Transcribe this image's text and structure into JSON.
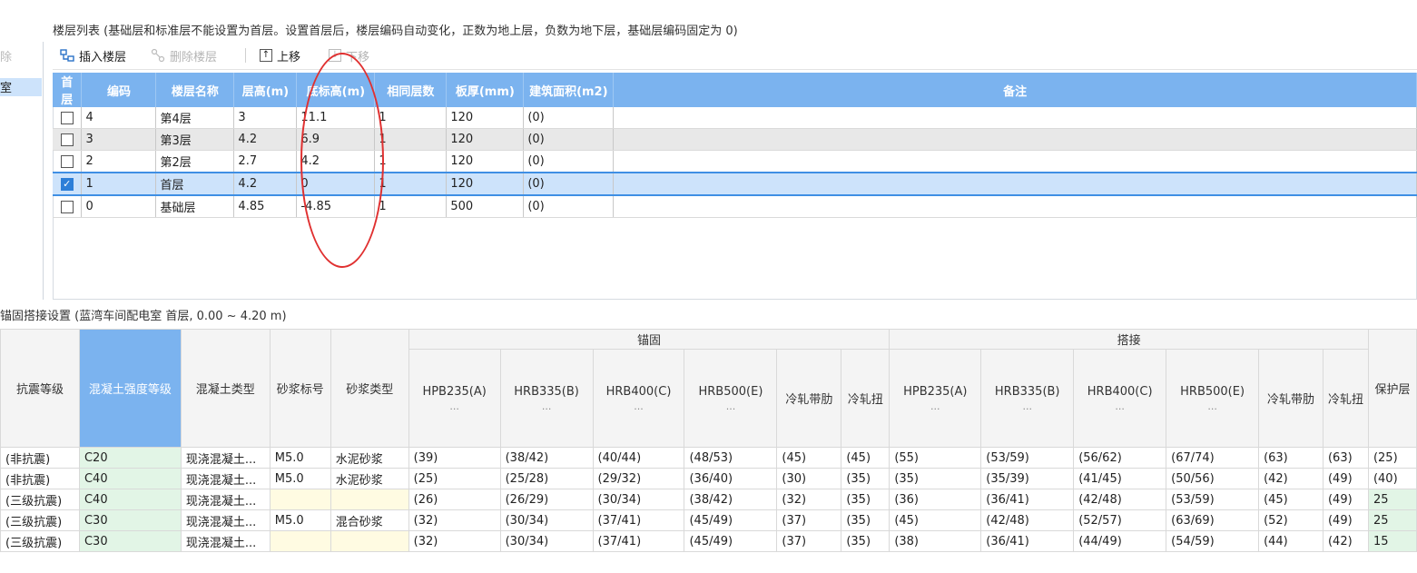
{
  "left": {
    "delete_label": "除",
    "selected_label": "室"
  },
  "floor_list": {
    "title": "楼层列表",
    "note": "(基础层和标准层不能设置为首层。设置首层后，楼层编码自动变化，正数为地上层，负数为地下层，基础层编码固定为 0)"
  },
  "toolbar": {
    "insert_label": "插入楼层",
    "delete_label": "删除楼层",
    "up_label": "上移",
    "down_label": "下移"
  },
  "floor_table": {
    "headers": [
      "首层",
      "编码",
      "楼层名称",
      "层高(m)",
      "底标高(m)",
      "相同层数",
      "板厚(mm)",
      "建筑面积(m2)",
      "备注"
    ],
    "rows": [
      {
        "first": false,
        "code": "4",
        "name": "第4层",
        "height": "3",
        "bottom": "11.1",
        "same": "1",
        "slab": "120",
        "area": "(0)",
        "remark": ""
      },
      {
        "first": false,
        "code": "3",
        "name": "第3层",
        "height": "4.2",
        "bottom": "6.9",
        "same": "1",
        "slab": "120",
        "area": "(0)",
        "remark": ""
      },
      {
        "first": false,
        "code": "2",
        "name": "第2层",
        "height": "2.7",
        "bottom": "4.2",
        "same": "1",
        "slab": "120",
        "area": "(0)",
        "remark": ""
      },
      {
        "first": true,
        "code": "1",
        "name": "首层",
        "height": "4.2",
        "bottom": "0",
        "same": "1",
        "slab": "120",
        "area": "(0)",
        "remark": ""
      },
      {
        "first": false,
        "code": "0",
        "name": "基础层",
        "height": "4.85",
        "bottom": "-4.85",
        "same": "1",
        "slab": "500",
        "area": "(0)",
        "remark": ""
      }
    ]
  },
  "anchor": {
    "title": "锚固搭接设置 (蓝湾车间配电室 首层, 0.00 ~ 4.20 m)",
    "group_anchor": "锚固",
    "group_lap": "搭接",
    "headers": {
      "seismic": "抗震等级",
      "concrete_grade": "混凝土强度等级",
      "concrete_type": "混凝土类型",
      "mortar_grade": "砂浆标号",
      "mortar_type": "砂浆类型",
      "hpb": "HPB235(A)",
      "hrb335": "HRB335(B)",
      "hrb400": "HRB400(C)",
      "hrb500": "HRB500(E)",
      "cold_rib": "冷轧带肋",
      "cold_twist": "冷轧扭",
      "cover": "保护层",
      "dots": "..."
    },
    "rows": [
      [
        "(非抗震)",
        "C20",
        "现浇混凝土...",
        "M5.0",
        "水泥砂浆",
        "(39)",
        "(38/42)",
        "(40/44)",
        "(48/53)",
        "(45)",
        "(45)",
        "(55)",
        "(53/59)",
        "(56/62)",
        "(67/74)",
        "(63)",
        "(63)",
        "(25)"
      ],
      [
        "(非抗震)",
        "C40",
        "现浇混凝土...",
        "M5.0",
        "水泥砂浆",
        "(25)",
        "(25/28)",
        "(29/32)",
        "(36/40)",
        "(30)",
        "(35)",
        "(35)",
        "(35/39)",
        "(41/45)",
        "(50/56)",
        "(42)",
        "(49)",
        "(40)"
      ],
      [
        "(三级抗震)",
        "C40",
        "现浇混凝土...",
        "",
        "",
        "(26)",
        "(26/29)",
        "(30/34)",
        "(38/42)",
        "(32)",
        "(35)",
        "(36)",
        "(36/41)",
        "(42/48)",
        "(53/59)",
        "(45)",
        "(49)",
        "25"
      ],
      [
        "(三级抗震)",
        "C30",
        "现浇混凝土...",
        "M5.0",
        "混合砂浆",
        "(32)",
        "(30/34)",
        "(37/41)",
        "(45/49)",
        "(37)",
        "(35)",
        "(45)",
        "(42/48)",
        "(52/57)",
        "(63/69)",
        "(52)",
        "(49)",
        "25"
      ],
      [
        "(三级抗震)",
        "C30",
        "现浇混凝土...",
        "",
        "",
        "(32)",
        "(30/34)",
        "(37/41)",
        "(45/49)",
        "(37)",
        "(35)",
        "(38)",
        "(36/41)",
        "(44/49)",
        "(54/59)",
        "(44)",
        "(42)",
        "15"
      ]
    ]
  }
}
